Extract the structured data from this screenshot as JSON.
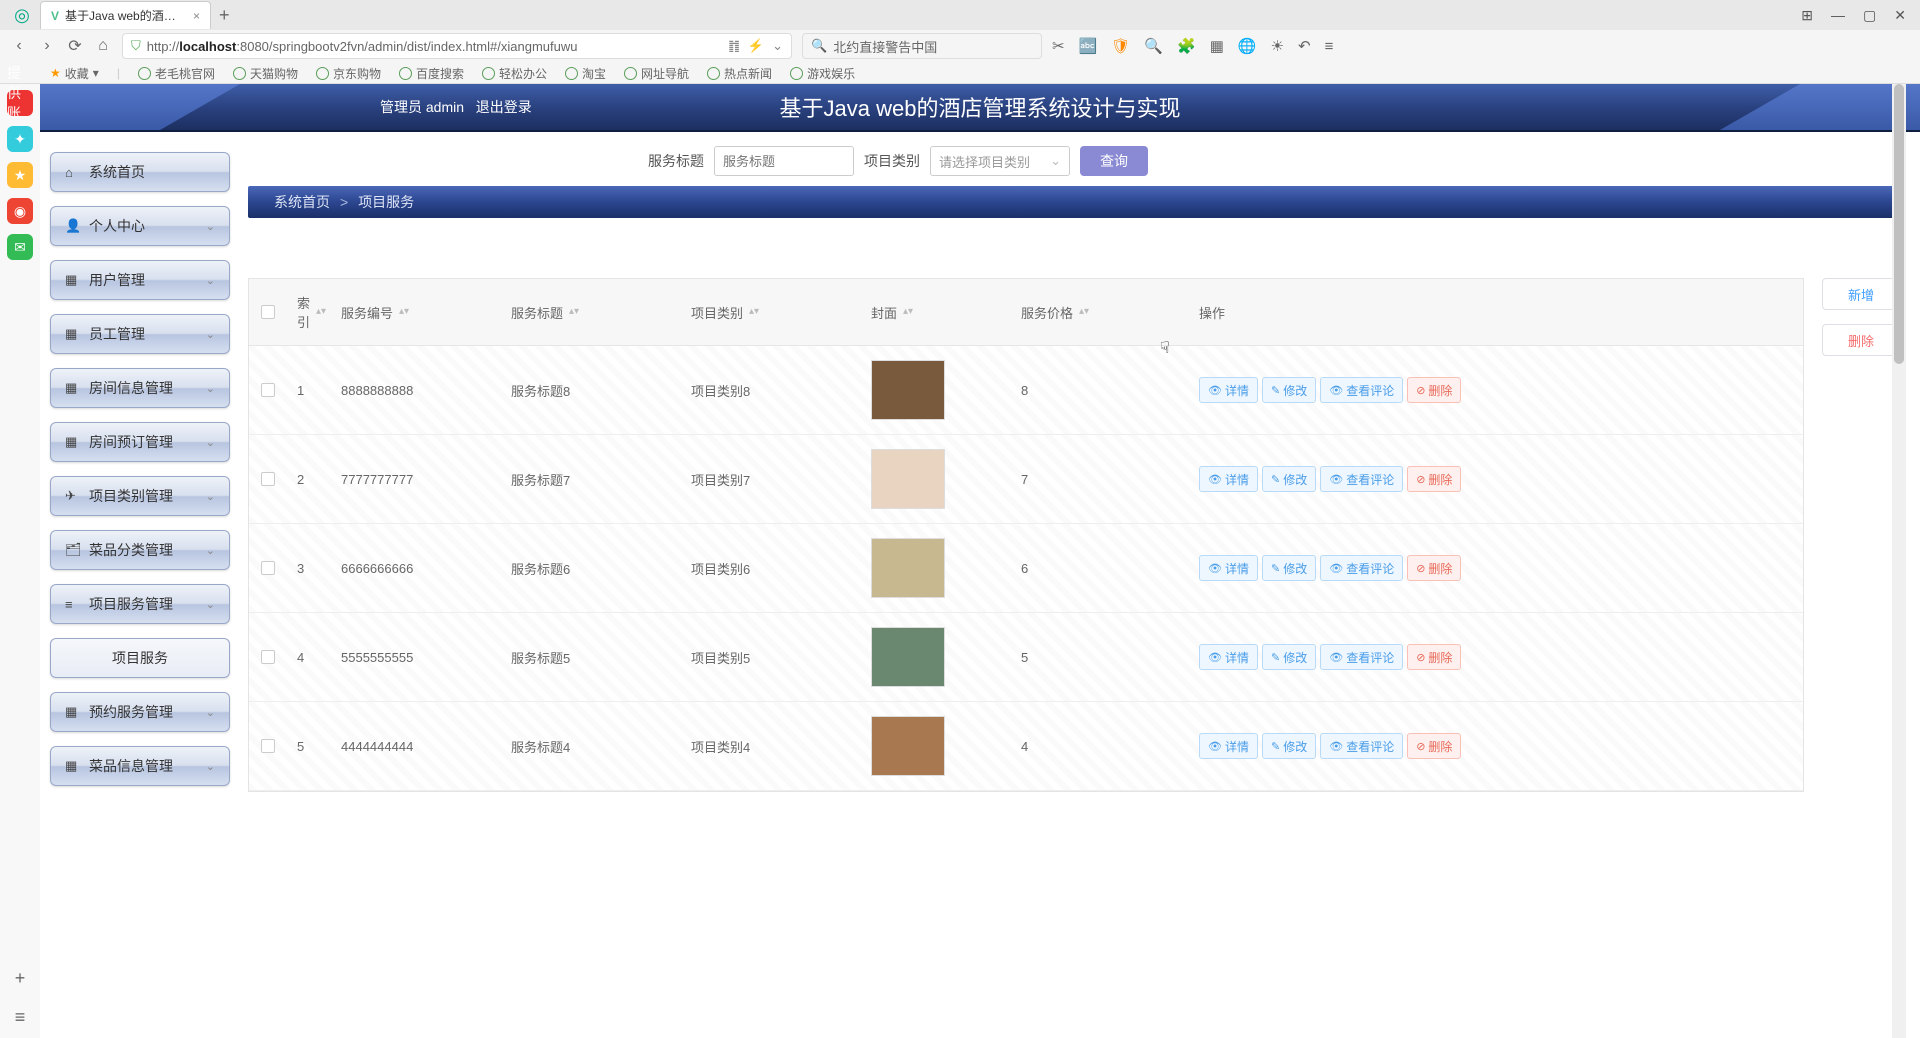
{
  "browser": {
    "tab_title": "基于Java web的酒店管理系统设...",
    "url_pre": "http://",
    "url_host": "localhost",
    "url_rest": ":8080/springbootv2fvn/admin/dist/index.html#/xiangmufuwu",
    "search_placeholder": "北约直接警告中国",
    "bookmarks_label": "收藏",
    "bookmarks": [
      "老毛桃官网",
      "天猫购物",
      "京东购物",
      "百度搜索",
      "轻松办公",
      "淘宝",
      "网址导航",
      "热点新闻",
      "游戏娱乐"
    ]
  },
  "header": {
    "admin_label": "管理员 admin",
    "logout": "退出登录",
    "title": "基于Java web的酒店管理系统设计与实现"
  },
  "sidebar": [
    {
      "icon": "⌂",
      "label": "系统首页",
      "expand": false
    },
    {
      "icon": "👤",
      "label": "个人中心",
      "expand": true
    },
    {
      "icon": "▦",
      "label": "用户管理",
      "expand": true
    },
    {
      "icon": "▦",
      "label": "员工管理",
      "expand": true
    },
    {
      "icon": "▦",
      "label": "房间信息管理",
      "expand": true
    },
    {
      "icon": "▦",
      "label": "房间预订管理",
      "expand": true
    },
    {
      "icon": "✈",
      "label": "项目类别管理",
      "expand": true
    },
    {
      "icon": "🗂",
      "label": "菜品分类管理",
      "expand": true
    },
    {
      "icon": "≡",
      "label": "项目服务管理",
      "expand": true
    },
    {
      "icon": "",
      "label": "项目服务",
      "expand": false,
      "sub": true
    },
    {
      "icon": "▦",
      "label": "预约服务管理",
      "expand": true
    },
    {
      "icon": "▦",
      "label": "菜品信息管理",
      "expand": true
    }
  ],
  "filter": {
    "title_label": "服务标题",
    "title_placeholder": "服务标题",
    "cat_label": "项目类别",
    "cat_placeholder": "请选择项目类别",
    "search_btn": "查询"
  },
  "breadcrumb": {
    "home": "系统首页",
    "current": "项目服务",
    "sep": ">"
  },
  "columns": {
    "idx": "索引",
    "code": "服务编号",
    "title": "服务标题",
    "cat": "项目类别",
    "img": "封面",
    "price": "服务价格",
    "ops": "操作"
  },
  "rows": [
    {
      "idx": "1",
      "code": "8888888888",
      "title": "服务标题8",
      "cat": "项目类别8",
      "price": "8",
      "thumb": "#7a5a3c"
    },
    {
      "idx": "2",
      "code": "7777777777",
      "title": "服务标题7",
      "cat": "项目类别7",
      "price": "7",
      "thumb": "#e8d4c0"
    },
    {
      "idx": "3",
      "code": "6666666666",
      "title": "服务标题6",
      "cat": "项目类别6",
      "price": "6",
      "thumb": "#c8b890"
    },
    {
      "idx": "4",
      "code": "5555555555",
      "title": "服务标题5",
      "cat": "项目类别5",
      "price": "5",
      "thumb": "#6a8870"
    },
    {
      "idx": "5",
      "code": "4444444444",
      "title": "服务标题4",
      "cat": "项目类别4",
      "price": "4",
      "thumb": "#a87850"
    }
  ],
  "ops": {
    "detail": "详情",
    "edit": "修改",
    "comments": "查看评论",
    "delete": "删除"
  },
  "side_btns": {
    "add": "新增",
    "del": "删除"
  }
}
